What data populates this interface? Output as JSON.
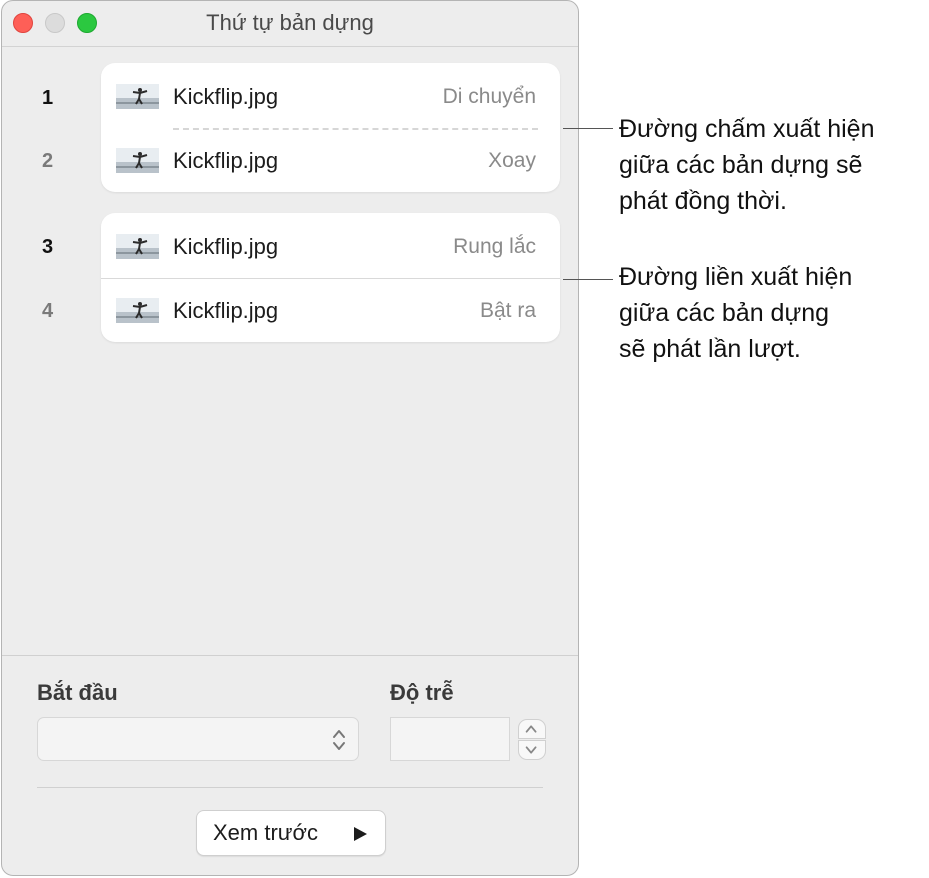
{
  "window": {
    "title": "Thứ tự bản dựng"
  },
  "builds": [
    {
      "number": "1",
      "file": "Kickflip.jpg",
      "effect": "Di chuyển"
    },
    {
      "number": "2",
      "file": "Kickflip.jpg",
      "effect": "Xoay"
    },
    {
      "number": "3",
      "file": "Kickflip.jpg",
      "effect": "Rung lắc"
    },
    {
      "number": "4",
      "file": "Kickflip.jpg",
      "effect": "Bật ra"
    }
  ],
  "controls": {
    "start_label": "Bắt đầu",
    "start_value": "",
    "delay_label": "Độ trễ",
    "delay_value": "",
    "preview_label": "Xem trước"
  },
  "callouts": [
    {
      "text": "Đường chấm xuất hiện\ngiữa các bản dựng sẽ\nphát đồng thời."
    },
    {
      "text": "Đường liền xuất hiện\ngiữa các bản dựng\nsẽ phát lần lượt."
    }
  ],
  "colors": {
    "close": "#fe5f57",
    "minimize": "#dcdcdc",
    "zoom": "#2bc840",
    "window_bg": "#ededed"
  },
  "icons": {
    "thumbnail": "skater-photo-thumbnail",
    "select_arrows": "chevron-up-down-icon",
    "stepper": "stepper-icon",
    "play": "play-triangle-icon"
  }
}
